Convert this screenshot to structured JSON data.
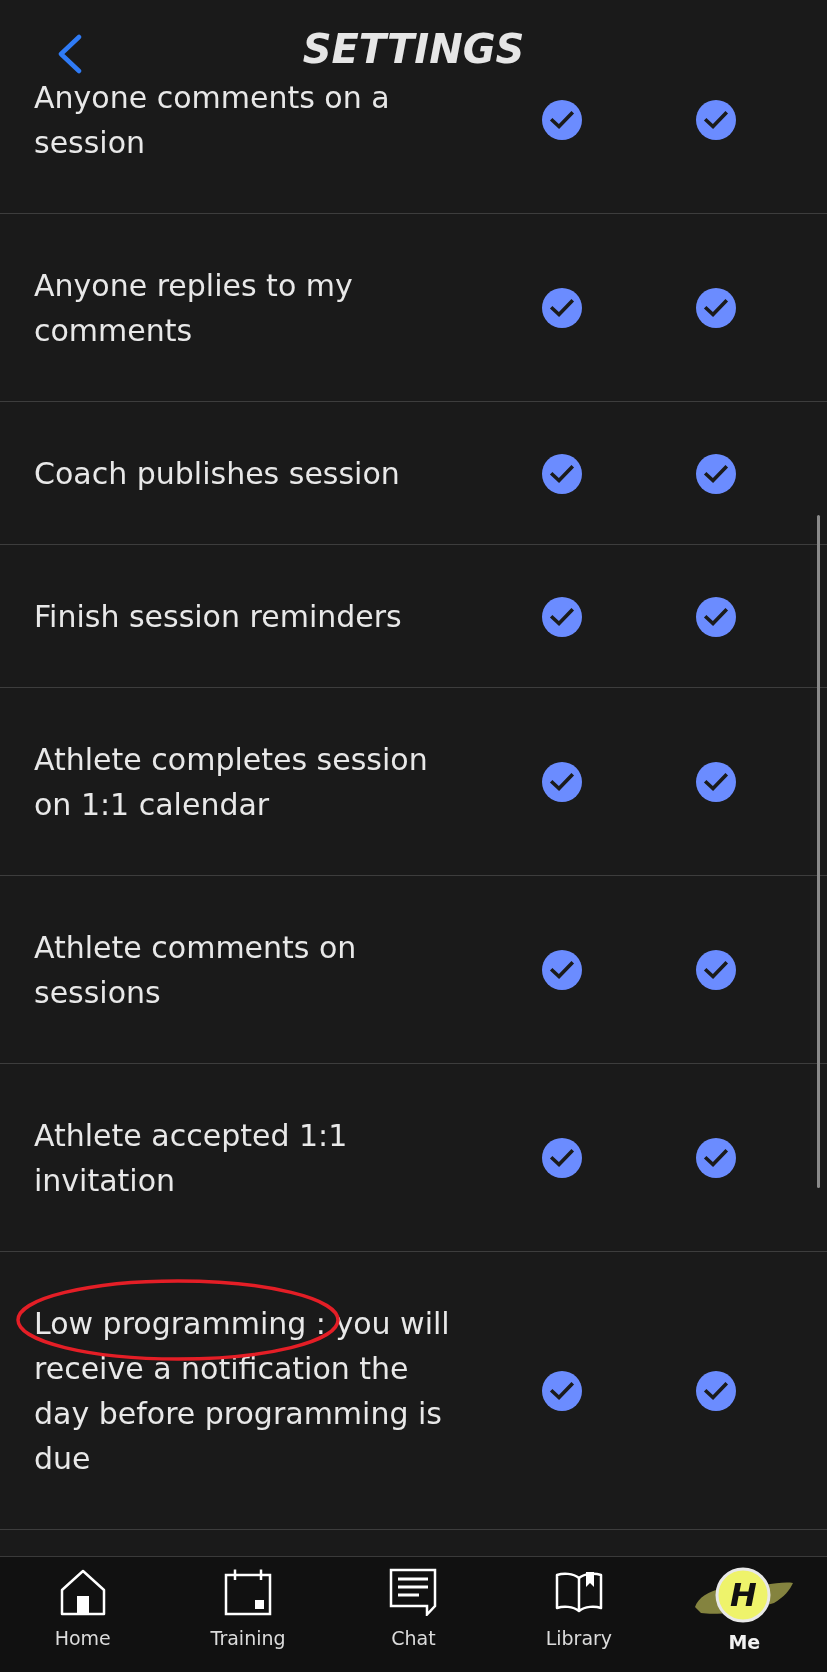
{
  "header": {
    "title": "SETTINGS"
  },
  "rows": [
    {
      "label": "Anyone comments on a session",
      "circled": false,
      "checks": [
        {
          "checked": true
        },
        {
          "checked": true
        }
      ]
    },
    {
      "label": "Anyone replies to my comments",
      "circled": false,
      "checks": [
        {
          "checked": true
        },
        {
          "checked": true
        }
      ]
    },
    {
      "label": "Coach publishes session",
      "circled": false,
      "checks": [
        {
          "checked": true
        },
        {
          "checked": true
        }
      ]
    },
    {
      "label": "Finish session reminders",
      "circled": false,
      "checks": [
        {
          "checked": true
        },
        {
          "checked": true
        }
      ]
    },
    {
      "label": "Athlete completes session on 1:1 calendar",
      "circled": false,
      "checks": [
        {
          "checked": true
        },
        {
          "checked": true
        }
      ]
    },
    {
      "label": "Athlete comments on sessions",
      "circled": false,
      "checks": [
        {
          "checked": true
        },
        {
          "checked": true
        }
      ]
    },
    {
      "label": "Athlete accepted 1:1 invitation",
      "circled": false,
      "checks": [
        {
          "checked": true
        },
        {
          "checked": true
        }
      ]
    },
    {
      "label": "Low programming : you will receive a notification the day before programming is due",
      "circled": true,
      "checks": [
        {
          "checked": true
        },
        {
          "checked": true
        }
      ]
    }
  ],
  "nav": [
    {
      "kind": "icon",
      "label": "Home",
      "selected": false
    },
    {
      "kind": "icon",
      "label": "Training",
      "selected": false
    },
    {
      "kind": "icon",
      "label": "Chat",
      "selected": false
    },
    {
      "kind": "icon",
      "label": "Library",
      "selected": false
    },
    {
      "kind": "avatar",
      "label": "Me",
      "avatar_text": "H",
      "selected": true
    }
  ]
}
